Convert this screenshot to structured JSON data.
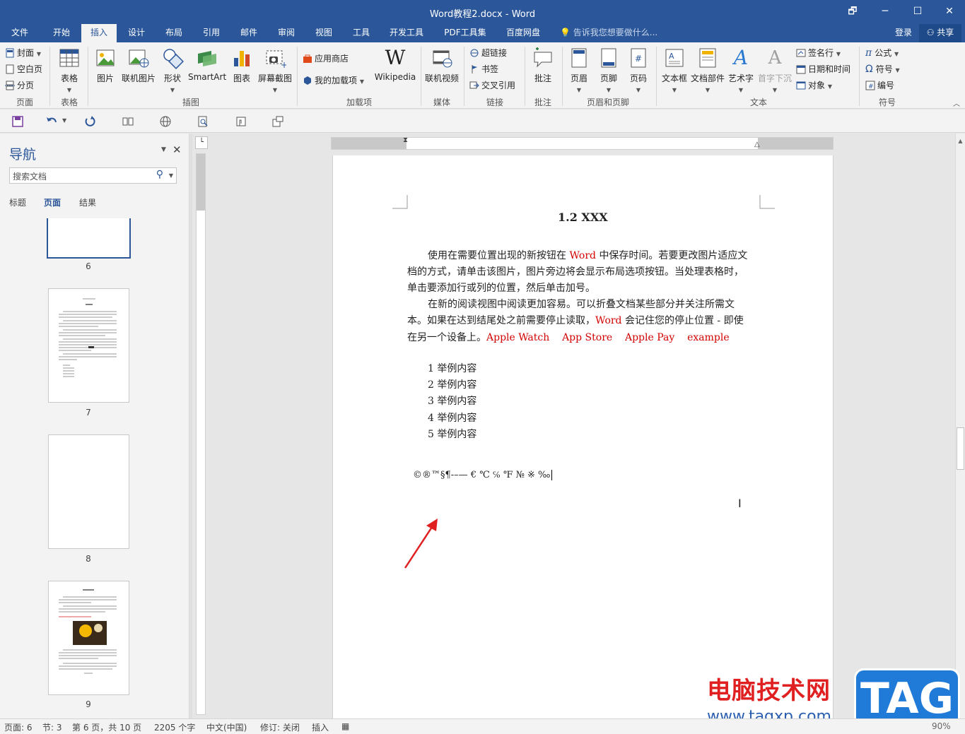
{
  "window": {
    "title": "Word教程2.docx - Word",
    "restore_glyph": "🗗",
    "minimize_glyph": "─",
    "maximize_glyph": "☐",
    "close_glyph": "✕"
  },
  "menu": {
    "tabs": [
      "文件",
      "开始",
      "插入",
      "设计",
      "布局",
      "引用",
      "邮件",
      "审阅",
      "视图",
      "工具",
      "开发工具",
      "PDF工具集",
      "百度网盘"
    ],
    "active_tab": "插入",
    "tell_me": "告诉我您想要做什么...",
    "login": "登录",
    "share": "共享"
  },
  "ribbon": {
    "groups": {
      "pages": "页面",
      "table": "表格",
      "illustrations": "插图",
      "addins": "加载项",
      "media": "媒体",
      "links": "链接",
      "comments": "批注",
      "header_footer": "页眉和页脚",
      "text": "文本",
      "symbols": "符号"
    },
    "pages": {
      "cover": "封面",
      "blank": "空白页",
      "break": "分页"
    },
    "table": {
      "table": "表格"
    },
    "illustrations": {
      "picture": "图片",
      "online_picture": "联机图片",
      "shapes": "形状",
      "smartart": "SmartArt",
      "chart": "图表",
      "screenshot": "屏幕截图"
    },
    "addins": {
      "store": "应用商店",
      "my_addins": "我的加载项",
      "wikipedia": "Wikipedia"
    },
    "media": {
      "online_video": "联机视频"
    },
    "links": {
      "hyperlink": "超链接",
      "bookmark": "书签",
      "cross_ref": "交叉引用"
    },
    "comments": {
      "comment": "批注"
    },
    "header_footer": {
      "header": "页眉",
      "footer": "页脚",
      "page_number": "页码"
    },
    "text": {
      "textbox": "文本框",
      "quick_parts": "文档部件",
      "wordart": "艺术字",
      "dropcap": "首字下沉",
      "signature": "签名行",
      "datetime": "日期和时间",
      "object": "对象"
    },
    "symbols": {
      "equation": "公式",
      "symbol": "符号",
      "numbering": "编号"
    }
  },
  "nav": {
    "title": "导航",
    "search_placeholder": "搜索文档",
    "tabs": [
      "标题",
      "页面",
      "结果"
    ],
    "active_tab": "页面",
    "page_numbers": [
      "6",
      "7",
      "8",
      "9"
    ]
  },
  "document": {
    "heading": "1.2 XXX",
    "p1_line1_a": "使用在需要位置出现的新按钮在",
    "p1_word": "Word",
    "p1_line1_b": "中保存时间。若要更改图片适应文",
    "p1_line2": "档的方式，请单击该图片，图片旁边将会显示布局选项按钮。当处理表格时，",
    "p1_line3": "单击要添加行或列的位置，然后单击加号。",
    "p2_line1": "在新的阅读视图中阅读更加容易。可以折叠文档某些部分并关注所需文",
    "p2_line2_a": "本。如果在达到结尾处之前需要停止读取，",
    "p2_word": "Word",
    "p2_line2_b": "会记住您的停止位置 - 即使",
    "p2_line3": "在另一个设备上。",
    "red_words": [
      "Apple Watch",
      "App Store",
      "Apple Pay",
      "example"
    ],
    "list_items": [
      "1 举例内容",
      "2 举例内容",
      "3 举例内容",
      "4 举例内容",
      "5 举例内容"
    ],
    "symbols_line": "©®™§¶-–— € ℃ ℅ ℉ № ※ ‰"
  },
  "status": {
    "page": "页面: 6",
    "section": "节: 3",
    "page_of": "第 6 页，共 10 页",
    "words": "2205 个字",
    "language": "中文(中国)",
    "track": "修订: 关闭",
    "mode": "插入",
    "zoom": "90%"
  },
  "watermark": {
    "text": "电脑技术网",
    "url": "www.tagxp.com",
    "logo": "TAG"
  },
  "colors": {
    "accent": "#2b579a",
    "red_text": "#d40000"
  }
}
